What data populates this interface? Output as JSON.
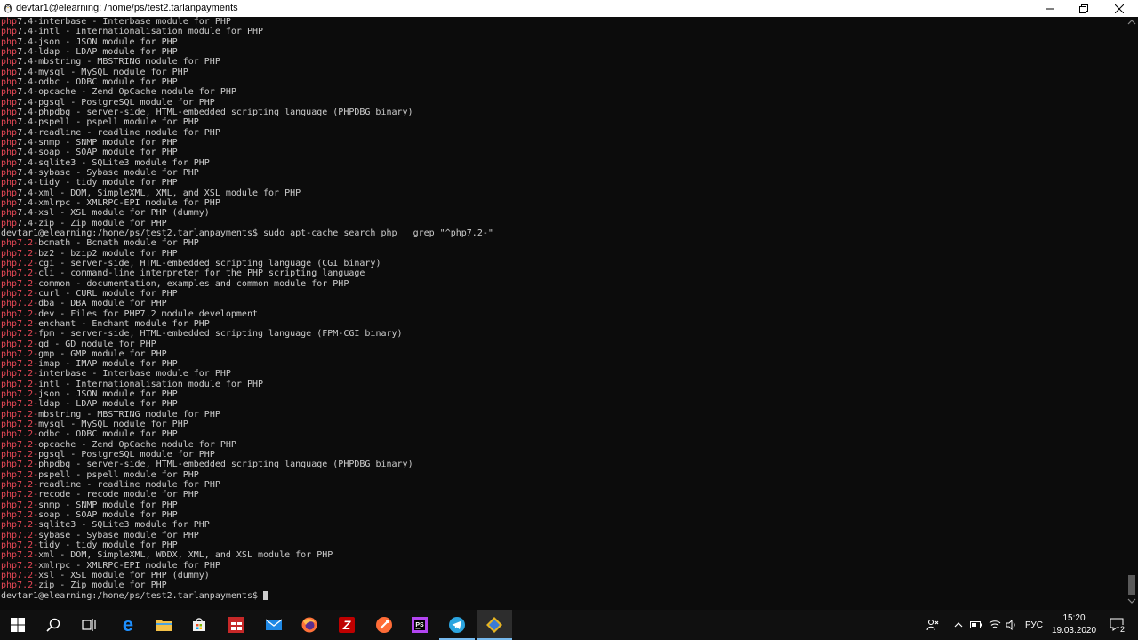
{
  "window": {
    "title": "devtar1@elearning: /home/ps/test2.tarlanpayments",
    "icon": "linux-penguin-icon"
  },
  "terminal": {
    "lines": [
      {
        "p": "php",
        "t": "7.4-interbase - Interbase module for PHP"
      },
      {
        "p": "php",
        "t": "7.4-intl - Internationalisation module for PHP"
      },
      {
        "p": "php",
        "t": "7.4-json - JSON module for PHP"
      },
      {
        "p": "php",
        "t": "7.4-ldap - LDAP module for PHP"
      },
      {
        "p": "php",
        "t": "7.4-mbstring - MBSTRING module for PHP"
      },
      {
        "p": "php",
        "t": "7.4-mysql - MySQL module for PHP"
      },
      {
        "p": "php",
        "t": "7.4-odbc - ODBC module for PHP"
      },
      {
        "p": "php",
        "t": "7.4-opcache - Zend OpCache module for PHP"
      },
      {
        "p": "php",
        "t": "7.4-pgsql - PostgreSQL module for PHP"
      },
      {
        "p": "php",
        "t": "7.4-phpdbg - server-side, HTML-embedded scripting language (PHPDBG binary)"
      },
      {
        "p": "php",
        "t": "7.4-pspell - pspell module for PHP"
      },
      {
        "p": "php",
        "t": "7.4-readline - readline module for PHP"
      },
      {
        "p": "php",
        "t": "7.4-snmp - SNMP module for PHP"
      },
      {
        "p": "php",
        "t": "7.4-soap - SOAP module for PHP"
      },
      {
        "p": "php",
        "t": "7.4-sqlite3 - SQLite3 module for PHP"
      },
      {
        "p": "php",
        "t": "7.4-sybase - Sybase module for PHP"
      },
      {
        "p": "php",
        "t": "7.4-tidy - tidy module for PHP"
      },
      {
        "p": "php",
        "t": "7.4-xml - DOM, SimpleXML, XML, and XSL module for PHP"
      },
      {
        "p": "php",
        "t": "7.4-xmlrpc - XMLRPC-EPI module for PHP"
      },
      {
        "p": "php",
        "t": "7.4-xsl - XSL module for PHP (dummy)"
      },
      {
        "p": "php",
        "t": "7.4-zip - Zip module for PHP"
      },
      {
        "p": "",
        "t": "devtar1@elearning:/home/ps/test2.tarlanpayments$ sudo apt-cache search php | grep \"^php7.2-\""
      },
      {
        "p": "php7.2-",
        "t": "bcmath - Bcmath module for PHP"
      },
      {
        "p": "php7.2-",
        "t": "bz2 - bzip2 module for PHP"
      },
      {
        "p": "php7.2-",
        "t": "cgi - server-side, HTML-embedded scripting language (CGI binary)"
      },
      {
        "p": "php7.2-",
        "t": "cli - command-line interpreter for the PHP scripting language"
      },
      {
        "p": "php7.2-",
        "t": "common - documentation, examples and common module for PHP"
      },
      {
        "p": "php7.2-",
        "t": "curl - CURL module for PHP"
      },
      {
        "p": "php7.2-",
        "t": "dba - DBA module for PHP"
      },
      {
        "p": "php7.2-",
        "t": "dev - Files for PHP7.2 module development"
      },
      {
        "p": "php7.2-",
        "t": "enchant - Enchant module for PHP"
      },
      {
        "p": "php7.2-",
        "t": "fpm - server-side, HTML-embedded scripting language (FPM-CGI binary)"
      },
      {
        "p": "php7.2-",
        "t": "gd - GD module for PHP"
      },
      {
        "p": "php7.2-",
        "t": "gmp - GMP module for PHP"
      },
      {
        "p": "php7.2-",
        "t": "imap - IMAP module for PHP"
      },
      {
        "p": "php7.2-",
        "t": "interbase - Interbase module for PHP"
      },
      {
        "p": "php7.2-",
        "t": "intl - Internationalisation module for PHP"
      },
      {
        "p": "php7.2-",
        "t": "json - JSON module for PHP"
      },
      {
        "p": "php7.2-",
        "t": "ldap - LDAP module for PHP"
      },
      {
        "p": "php7.2-",
        "t": "mbstring - MBSTRING module for PHP"
      },
      {
        "p": "php7.2-",
        "t": "mysql - MySQL module for PHP"
      },
      {
        "p": "php7.2-",
        "t": "odbc - ODBC module for PHP"
      },
      {
        "p": "php7.2-",
        "t": "opcache - Zend OpCache module for PHP"
      },
      {
        "p": "php7.2-",
        "t": "pgsql - PostgreSQL module for PHP"
      },
      {
        "p": "php7.2-",
        "t": "phpdbg - server-side, HTML-embedded scripting language (PHPDBG binary)"
      },
      {
        "p": "php7.2-",
        "t": "pspell - pspell module for PHP"
      },
      {
        "p": "php7.2-",
        "t": "readline - readline module for PHP"
      },
      {
        "p": "php7.2-",
        "t": "recode - recode module for PHP"
      },
      {
        "p": "php7.2-",
        "t": "snmp - SNMP module for PHP"
      },
      {
        "p": "php7.2-",
        "t": "soap - SOAP module for PHP"
      },
      {
        "p": "php7.2-",
        "t": "sqlite3 - SQLite3 module for PHP"
      },
      {
        "p": "php7.2-",
        "t": "sybase - Sybase module for PHP"
      },
      {
        "p": "php7.2-",
        "t": "tidy - tidy module for PHP"
      },
      {
        "p": "php7.2-",
        "t": "xml - DOM, SimpleXML, WDDX, XML, and XSL module for PHP"
      },
      {
        "p": "php7.2-",
        "t": "xmlrpc - XMLRPC-EPI module for PHP"
      },
      {
        "p": "php7.2-",
        "t": "xsl - XSL module for PHP (dummy)"
      },
      {
        "p": "php7.2-",
        "t": "zip - Zip module for PHP"
      },
      {
        "p": "",
        "t": "devtar1@elearning:/home/ps/test2.tarlanpayments$ "
      }
    ]
  },
  "taskbar": {
    "apps": [
      {
        "name": "taskbar-windows-start-icon"
      },
      {
        "name": "taskbar-search-icon"
      },
      {
        "name": "taskbar-task-view-icon"
      },
      {
        "name": "taskbar-edge-icon"
      },
      {
        "name": "taskbar-file-explorer-icon"
      },
      {
        "name": "taskbar-store-icon"
      },
      {
        "name": "taskbar-red-app-icon"
      },
      {
        "name": "taskbar-mail-icon"
      },
      {
        "name": "taskbar-firefox-icon"
      },
      {
        "name": "taskbar-filezilla-icon"
      },
      {
        "name": "taskbar-postman-icon"
      },
      {
        "name": "taskbar-phpstorm-icon"
      },
      {
        "name": "taskbar-telegram-icon"
      },
      {
        "name": "taskbar-terminal-active-icon"
      }
    ],
    "language": "РУС",
    "time": "15:20",
    "date": "19.03.2020",
    "notification_count": "2"
  },
  "colors": {
    "terminal_bg": "#0c0c0c",
    "terminal_fg": "#cccccc",
    "prefix_red": "#e74856",
    "taskbar_bg": "#101010",
    "accent": "#76b9ed"
  }
}
